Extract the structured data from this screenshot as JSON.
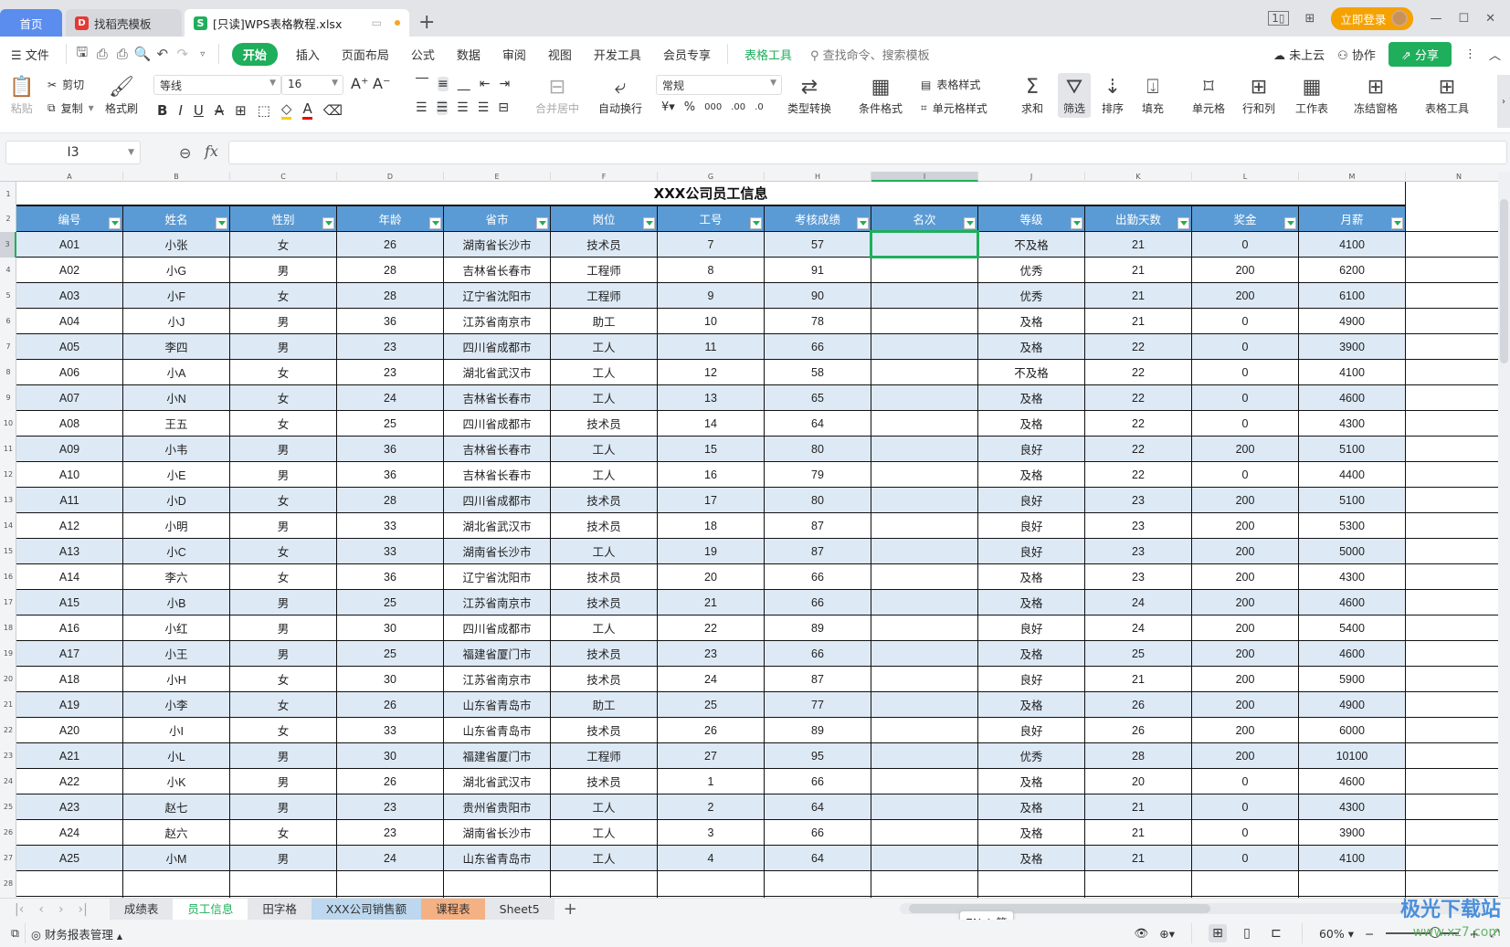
{
  "titlebar": {
    "tabs": [
      {
        "label": "首页"
      },
      {
        "label": "找稻壳模板",
        "icon": "docer-icon"
      },
      {
        "label": "[只读]WPS表格教程.xlsx",
        "icon": "spreadsheet-icon"
      }
    ],
    "login_label": "立即登录"
  },
  "menubar": {
    "file_label": "文件",
    "items": [
      "开始",
      "插入",
      "页面布局",
      "公式",
      "数据",
      "审阅",
      "视图",
      "开发工具",
      "会员专享"
    ],
    "context_tab": "表格工具",
    "search_placeholder": "查找命令、搜索模板",
    "cloud_label": "未上云",
    "collab_label": "协作",
    "share_label": "分享"
  },
  "ribbon": {
    "paste": "粘贴",
    "cut": "剪切",
    "copy": "复制",
    "format_painter": "格式刷",
    "font_name": "等线",
    "font_size": "16",
    "merge_center": "合并居中",
    "wrap_text": "自动换行",
    "number_format": "常规",
    "type_convert": "类型转换",
    "conditional_format": "条件格式",
    "table_style": "表格样式",
    "cell_style": "单元格样式",
    "sum": "求和",
    "filter": "筛选",
    "sort": "排序",
    "fill": "填充",
    "cell": "单元格",
    "row_col": "行和列",
    "worksheet": "工作表",
    "freeze": "冻结窗格",
    "table_tools": "表格工具"
  },
  "formula_bar": {
    "name_box": "I3",
    "fx": "fx",
    "formula": ""
  },
  "sheet": {
    "column_letters": [
      "A",
      "B",
      "C",
      "D",
      "E",
      "F",
      "G",
      "H",
      "I",
      "J",
      "K",
      "L",
      "M",
      "N"
    ],
    "selected_column": "I",
    "selected_row": 3,
    "title": "XXX公司员工信息",
    "headers": [
      "编号",
      "姓名",
      "性别",
      "年龄",
      "省市",
      "岗位",
      "工号",
      "考核成绩",
      "名次",
      "等级",
      "出勤天数",
      "奖金",
      "月薪"
    ],
    "rows": [
      [
        "A01",
        "小张",
        "女",
        "26",
        "湖南省长沙市",
        "技术员",
        "7",
        "57",
        "",
        "不及格",
        "21",
        "0",
        "4100"
      ],
      [
        "A02",
        "小G",
        "男",
        "28",
        "吉林省长春市",
        "工程师",
        "8",
        "91",
        "",
        "优秀",
        "21",
        "200",
        "6200"
      ],
      [
        "A03",
        "小F",
        "女",
        "28",
        "辽宁省沈阳市",
        "工程师",
        "9",
        "90",
        "",
        "优秀",
        "21",
        "200",
        "6100"
      ],
      [
        "A04",
        "小J",
        "男",
        "36",
        "江苏省南京市",
        "助工",
        "10",
        "78",
        "",
        "及格",
        "21",
        "0",
        "4900"
      ],
      [
        "A05",
        "李四",
        "男",
        "23",
        "四川省成都市",
        "工人",
        "11",
        "66",
        "",
        "及格",
        "22",
        "0",
        "3900"
      ],
      [
        "A06",
        "小A",
        "女",
        "23",
        "湖北省武汉市",
        "工人",
        "12",
        "58",
        "",
        "不及格",
        "22",
        "0",
        "4100"
      ],
      [
        "A07",
        "小N",
        "女",
        "24",
        "吉林省长春市",
        "工人",
        "13",
        "65",
        "",
        "及格",
        "22",
        "0",
        "4600"
      ],
      [
        "A08",
        "王五",
        "女",
        "25",
        "四川省成都市",
        "技术员",
        "14",
        "64",
        "",
        "及格",
        "22",
        "0",
        "4300"
      ],
      [
        "A09",
        "小韦",
        "男",
        "36",
        "吉林省长春市",
        "工人",
        "15",
        "80",
        "",
        "良好",
        "22",
        "200",
        "5100"
      ],
      [
        "A10",
        "小E",
        "男",
        "36",
        "吉林省长春市",
        "工人",
        "16",
        "79",
        "",
        "及格",
        "22",
        "0",
        "4400"
      ],
      [
        "A11",
        "小D",
        "女",
        "28",
        "四川省成都市",
        "技术员",
        "17",
        "80",
        "",
        "良好",
        "23",
        "200",
        "5100"
      ],
      [
        "A12",
        "小明",
        "男",
        "33",
        "湖北省武汉市",
        "技术员",
        "18",
        "87",
        "",
        "良好",
        "23",
        "200",
        "5300"
      ],
      [
        "A13",
        "小C",
        "女",
        "33",
        "湖南省长沙市",
        "工人",
        "19",
        "87",
        "",
        "良好",
        "23",
        "200",
        "5000"
      ],
      [
        "A14",
        "李六",
        "女",
        "36",
        "辽宁省沈阳市",
        "技术员",
        "20",
        "66",
        "",
        "及格",
        "23",
        "200",
        "4300"
      ],
      [
        "A15",
        "小B",
        "男",
        "25",
        "江苏省南京市",
        "技术员",
        "21",
        "66",
        "",
        "及格",
        "24",
        "200",
        "4600"
      ],
      [
        "A16",
        "小红",
        "男",
        "30",
        "四川省成都市",
        "工人",
        "22",
        "89",
        "",
        "良好",
        "24",
        "200",
        "5400"
      ],
      [
        "A17",
        "小王",
        "男",
        "25",
        "福建省厦门市",
        "技术员",
        "23",
        "66",
        "",
        "及格",
        "25",
        "200",
        "4600"
      ],
      [
        "A18",
        "小H",
        "女",
        "30",
        "江苏省南京市",
        "技术员",
        "24",
        "87",
        "",
        "良好",
        "21",
        "200",
        "5900"
      ],
      [
        "A19",
        "小李",
        "女",
        "26",
        "山东省青岛市",
        "助工",
        "25",
        "77",
        "",
        "及格",
        "26",
        "200",
        "4900"
      ],
      [
        "A20",
        "小I",
        "女",
        "33",
        "山东省青岛市",
        "技术员",
        "26",
        "89",
        "",
        "良好",
        "26",
        "200",
        "6000"
      ],
      [
        "A21",
        "小L",
        "男",
        "30",
        "福建省厦门市",
        "工程师",
        "27",
        "95",
        "",
        "优秀",
        "28",
        "200",
        "10100"
      ],
      [
        "A22",
        "小K",
        "男",
        "26",
        "湖北省武汉市",
        "技术员",
        "1",
        "66",
        "",
        "及格",
        "20",
        "0",
        "4600"
      ],
      [
        "A23",
        "赵七",
        "男",
        "23",
        "贵州省贵阳市",
        "工人",
        "2",
        "64",
        "",
        "及格",
        "21",
        "0",
        "4300"
      ],
      [
        "A24",
        "赵六",
        "女",
        "23",
        "湖南省长沙市",
        "工人",
        "3",
        "66",
        "",
        "及格",
        "21",
        "0",
        "3900"
      ],
      [
        "A25",
        "小M",
        "男",
        "24",
        "山东省青岛市",
        "工人",
        "4",
        "64",
        "",
        "及格",
        "21",
        "0",
        "4100"
      ]
    ]
  },
  "sheet_tabs": [
    {
      "label": "成绩表",
      "style": ""
    },
    {
      "label": "员工信息",
      "style": "active"
    },
    {
      "label": "田字格",
      "style": ""
    },
    {
      "label": "XXX公司销售额",
      "style": "blue"
    },
    {
      "label": "课程表",
      "style": "orange"
    },
    {
      "label": "Sheet5",
      "style": ""
    }
  ],
  "ime": "EN ♪ 简",
  "statusbar": {
    "macro_label": "财务报表管理",
    "zoom": "60%",
    "zoom_fraction": 0.6
  },
  "watermark": {
    "title": "极光下载站",
    "url": "www.xz7.com"
  },
  "colors": {
    "accent": "#1fae5b",
    "header_blue": "#5b9bd5",
    "stripe": "#dde9f5"
  }
}
